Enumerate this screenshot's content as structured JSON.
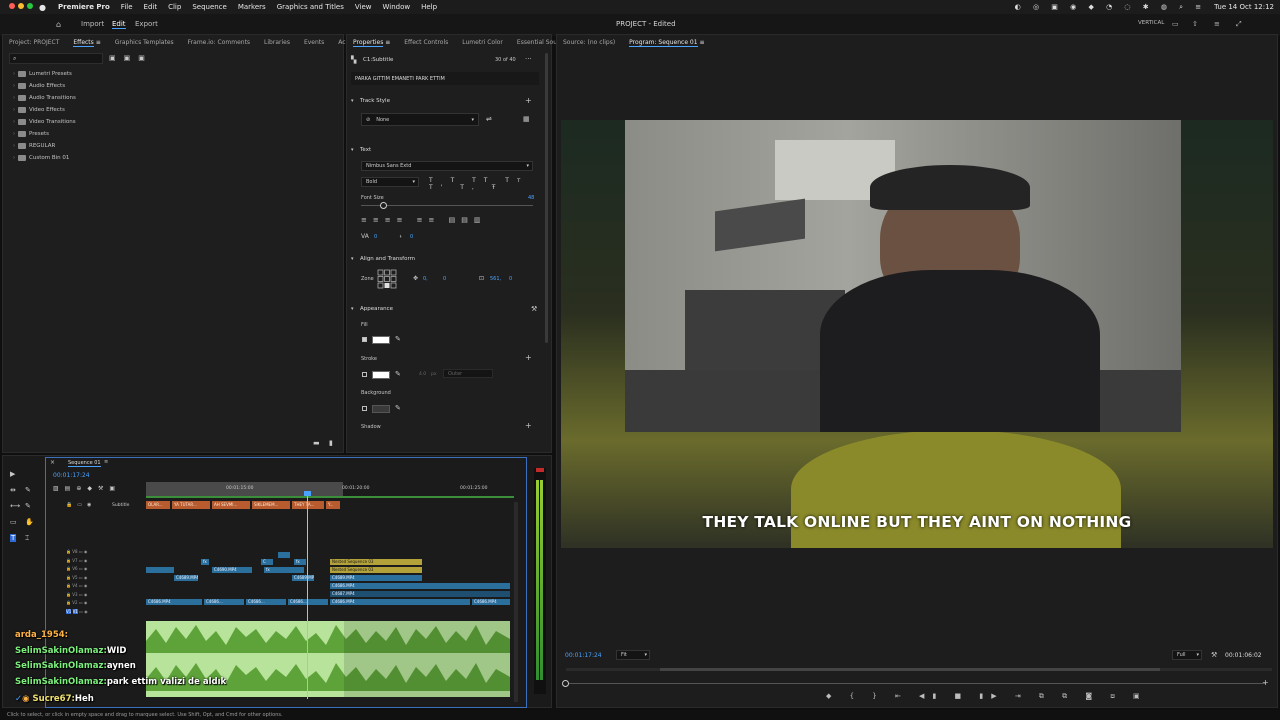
{
  "menubar": {
    "app": "Premiere Pro",
    "items": [
      "File",
      "Edit",
      "Clip",
      "Sequence",
      "Markers",
      "Graphics and Titles",
      "View",
      "Window",
      "Help"
    ],
    "datetime": "Tue 14 Oct  12:12"
  },
  "appbar": {
    "workspaces": [
      "Import",
      "Edit",
      "Export"
    ],
    "active_workspace": "Edit",
    "project_title": "PROJECT - Edited",
    "layout_label": "VERTICAL"
  },
  "left_panel": {
    "tabs": [
      "Project: PROJECT",
      "Effects",
      "Graphics Templates",
      "Frame.io: Comments",
      "Libraries",
      "Events",
      "Ac"
    ],
    "active_tab": "Effects",
    "tree": [
      "Lumetri Presets",
      "Audio Effects",
      "Audio Transitions",
      "Video Effects",
      "Video Transitions",
      "Presets",
      "REGULAR",
      "Custom Bin 01"
    ]
  },
  "properties": {
    "tabs": [
      "Properties",
      "Effect Controls",
      "Lumetri Color",
      "Essential Soun"
    ],
    "active_tab": "Properties",
    "clip_name": "C1:Subtitle",
    "count": "30 of 40",
    "caption_text": "PARKA GITTIM EMANETI PARK ETTIM",
    "track_style_header": "Track Style",
    "track_style_value": "None",
    "text_header": "Text",
    "font_family": "Nimbus Sans Extd",
    "font_style": "Bold",
    "font_size_label": "Font Size",
    "font_size_value": "48",
    "align_header": "Align and Transform",
    "zone_label": "Zone",
    "pos_x": "0,",
    "pos_y": "0",
    "scale_x": "561,",
    "scale_y": "0",
    "tracking_val": "0",
    "leading_val": "0",
    "appearance_header": "Appearance",
    "fill_label": "Fill",
    "stroke_label": "Stroke",
    "stroke_width": "4.0",
    "stroke_unit": "px",
    "stroke_type": "Outer",
    "background_label": "Background",
    "shadow_label": "Shadow"
  },
  "timeline": {
    "sequence_tab": "Sequence 01",
    "timecode": "00:01:17:24",
    "ruler": [
      "00:01:15:00",
      "00:01:20:00",
      "00:01:25:00"
    ],
    "subtitle_track_label": "Subtitle",
    "subtitle_clips": [
      "OLAR...",
      "YA TUTAR...",
      "AH SEVMI...",
      "SIKLEMEM...",
      "THEY TA...",
      "Y..."
    ],
    "video_tracks": [
      "V8",
      "V7",
      "V6",
      "V5",
      "V4",
      "V3",
      "V2",
      "V1"
    ],
    "clips": {
      "c6690": "C4690.MP4",
      "c6689": "C4689.MP4",
      "nested1": "Nested Sequence 03",
      "nested2": "Nested Sequence 03",
      "v5a": "C4689.MP4",
      "v4a": "C4686.MP4",
      "v3a": "C4687.MP4",
      "v2a": "C4686.MP4",
      "v2b": "C4686...",
      "v2c": "C4686...",
      "v2d": "C4686...",
      "v2e": "C4686.MP4",
      "v2f": "C4686.MP4",
      "c": "C",
      "fx": "fx"
    }
  },
  "chat": [
    {
      "user": "arda_1954:",
      "msg": "",
      "color": "orange"
    },
    {
      "user": "SelimSakinOlamaz:",
      "msg": "WID",
      "color": "green"
    },
    {
      "user": "SelimSakinOlamaz:",
      "msg": "aynen",
      "color": "green"
    },
    {
      "user": "SelimSakinOlamaz:",
      "msg": "park ettim valizi de aldık",
      "color": "green"
    },
    {
      "user": "Sucre67:",
      "msg": "Heh",
      "color": "yellow"
    }
  ],
  "source_monitor": {
    "label": "Source: (no clips)"
  },
  "program_monitor": {
    "label": "Program: Sequence 01",
    "caption": "THEY TALK ONLINE BUT THEY AINT ON NOTHING",
    "timecode": "00:01:17:24",
    "fit": "Fit",
    "quality": "Full",
    "duration": "00:01:06:02"
  },
  "status_text": "Click to select, or click in empty space and drag to marquee select. Use Shift, Opt, and Cmd for other options.",
  "colors": {
    "accent": "#4aa3ff",
    "subtitle_clip": "#b85b2e",
    "video_clip": "#2b6f9d",
    "nested_clip": "#b3a13a",
    "audio_clip": "#8fcf62"
  }
}
